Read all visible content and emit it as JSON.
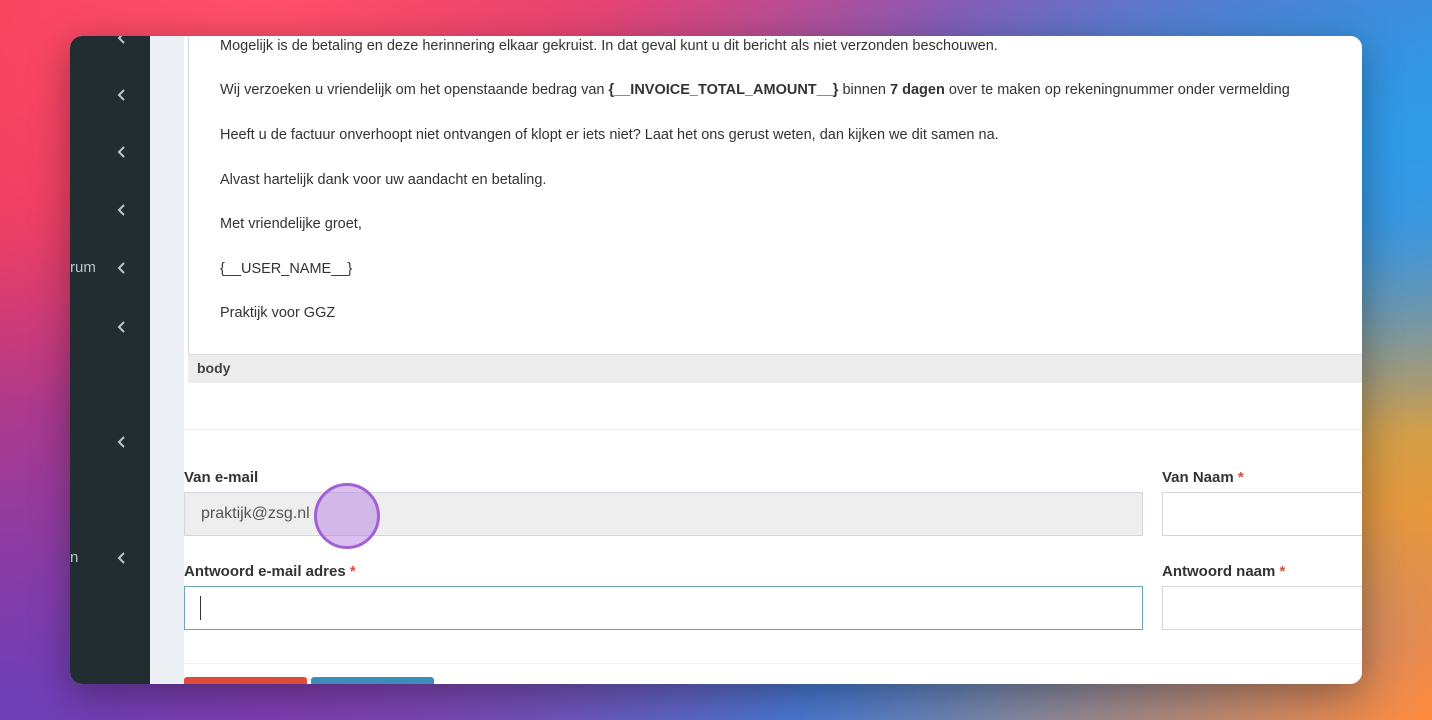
{
  "sidebar": {
    "items": [
      {
        "label": "",
        "icon": "chevron-left-icon"
      },
      {
        "label": "",
        "icon": "chevron-left-icon"
      },
      {
        "label": "",
        "icon": "chevron-left-icon"
      },
      {
        "label": "",
        "icon": "chevron-left-icon"
      },
      {
        "label": "rum",
        "icon": "chevron-left-icon"
      },
      {
        "label": "",
        "icon": "chevron-left-icon"
      },
      {
        "label": "",
        "icon": "chevron-left-icon"
      },
      {
        "label": "n",
        "icon": "chevron-left-icon"
      }
    ]
  },
  "editor": {
    "line1": "Mogelijk is de betaling en deze herinnering elkaar gekruist. In dat geval kunt u dit bericht als niet verzonden beschouwen.",
    "line2_a": "Wij verzoeken u vriendelijk om het openstaande bedrag van ",
    "line2_b": "{__INVOICE_TOTAL_AMOUNT__}",
    "line2_c": " binnen ",
    "line2_d": "7 dagen",
    "line2_e": " over te maken op rekeningnummer onder vermelding",
    "line3": "Heeft u de factuur onverhoopt niet ontvangen of klopt er iets niet? Laat het ons gerust weten, dan kijken we dit samen na.",
    "line4": "Alvast hartelijk dank voor uw aandacht en betaling.",
    "line5": "Met vriendelijke groet,",
    "line6": "{__USER_NAME__}",
    "line7": "Praktijk voor GGZ",
    "status_path": "body"
  },
  "form": {
    "from_email_label": "Van e-mail",
    "from_email_value": "praktijk@zsg.nl",
    "from_name_label": "Van Naam",
    "reply_email_label": "Antwoord e-mail adres",
    "reply_email_value": "",
    "reply_name_label": "Antwoord naam",
    "required_mark": "*"
  },
  "colors": {
    "sidebar_bg": "#222d32",
    "danger": "#dd4b39",
    "primary": "#3c8dbc",
    "focus_border": "#6aa7b5"
  }
}
